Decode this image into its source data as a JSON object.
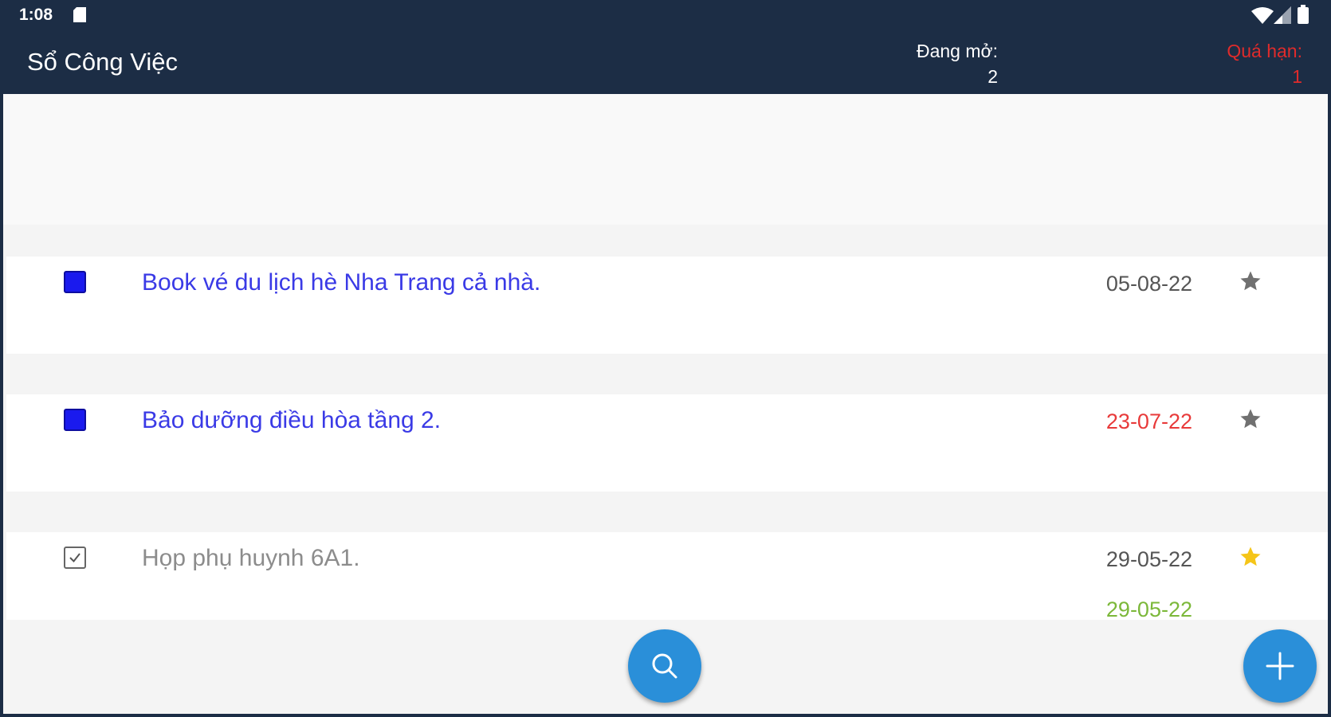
{
  "status_bar": {
    "time": "1:08",
    "icons": [
      "sd-card-icon",
      "wifi-icon",
      "signal-icon",
      "battery-icon"
    ]
  },
  "app_bar": {
    "title": "Sổ Công Việc",
    "open_label": "Đang mở:",
    "open_count": "2",
    "overdue_label": "Quá hạn:",
    "overdue_count": "1"
  },
  "colors": {
    "app_bar": "#1c2d45",
    "open_task_text": "#3a3ae6",
    "done_task_text": "#8c8c8c",
    "overdue_date": "#e83a3a",
    "completed_date": "#7cb83a",
    "star_default": "#707070",
    "star_active": "#f5c518",
    "fab": "#2a8fd9"
  },
  "tasks": [
    {
      "title": "Book vé du lịch hè Nha Trang cả nhà.",
      "date": "05-08-22",
      "status": "open",
      "starred": false
    },
    {
      "title": "Bảo dưỡng điều hòa tầng 2.",
      "date": "23-07-22",
      "status": "open",
      "overdue": true,
      "starred": false
    },
    {
      "title": "Họp phụ huynh 6A1.",
      "date": "29-05-22",
      "completed_date": "29-05-22",
      "status": "done",
      "starred": true
    }
  ],
  "fab": {
    "search_icon": "search-icon",
    "add_icon": "plus-icon"
  }
}
